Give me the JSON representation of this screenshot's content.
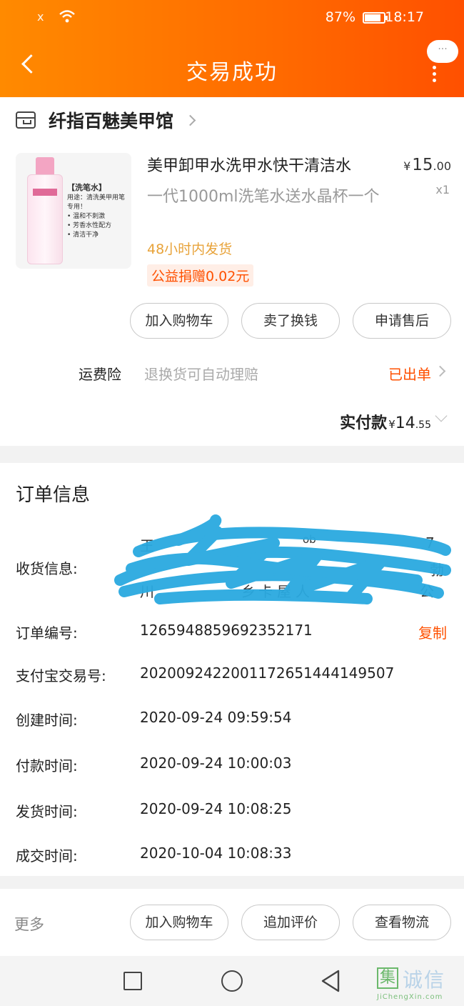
{
  "status_bar": {
    "battery": "87%",
    "time": "18:17"
  },
  "header": {
    "title": "交易成功",
    "bubble": "···"
  },
  "shop": {
    "name": "纤指百魅美甲馆"
  },
  "product": {
    "title": "美甲卸甲水洗甲水快干清洁水",
    "spec": "一代1000ml洗笔水送水晶杯一个",
    "price_currency": "¥",
    "price_int": "15",
    "price_dec": ".00",
    "qty": "x1",
    "ship_note": "48小时内发货",
    "charity": "公益捐赠0.02元",
    "image_text": {
      "name": "【洗笔水】",
      "usage": "用途：清洗美甲用笔专用！",
      "points": [
        "温和不刺激",
        "芳香水性配方",
        "清洁干净"
      ]
    }
  },
  "actions_top": [
    "加入购物车",
    "卖了换钱",
    "申请售后"
  ],
  "insurance": {
    "label": "运费险",
    "desc": "退换货可自动理赔",
    "status": "已出单"
  },
  "payment": {
    "label": "实付款",
    "currency": "¥",
    "int": "14",
    "dec": ".55"
  },
  "order_info": {
    "title": "订单信息",
    "rows": [
      {
        "label": "收货信息:"
      },
      {
        "label": "订单编号:",
        "value": "1265948859692352171",
        "action": "复制"
      },
      {
        "label": "支付宝交易号:",
        "value": "2020092422001172651444149507"
      },
      {
        "label": "创建时间:",
        "value": "2020-09-24 09:59:54"
      },
      {
        "label": "付款时间:",
        "value": "2020-09-24 10:00:03"
      },
      {
        "label": "发货时间:",
        "value": "2020-09-24 10:08:25"
      },
      {
        "label": "成交时间:",
        "value": "2020-10-04 10:08:33"
      }
    ],
    "address_fragments": [
      "王",
      "川",
      "ob",
      "7",
      "勃",
      "公",
      "乡",
      "卡",
      "屋",
      "人"
    ]
  },
  "footer": {
    "more": "更多",
    "buttons": [
      "加入购物车",
      "追加评价",
      "查看物流"
    ]
  },
  "watermark": {
    "box": "集",
    "text": "诚信",
    "url": "JiChengXin.com"
  },
  "colors": {
    "accent": "#ff5000",
    "header_start": "#ff8a00",
    "scribble": "#2aa9e0"
  }
}
